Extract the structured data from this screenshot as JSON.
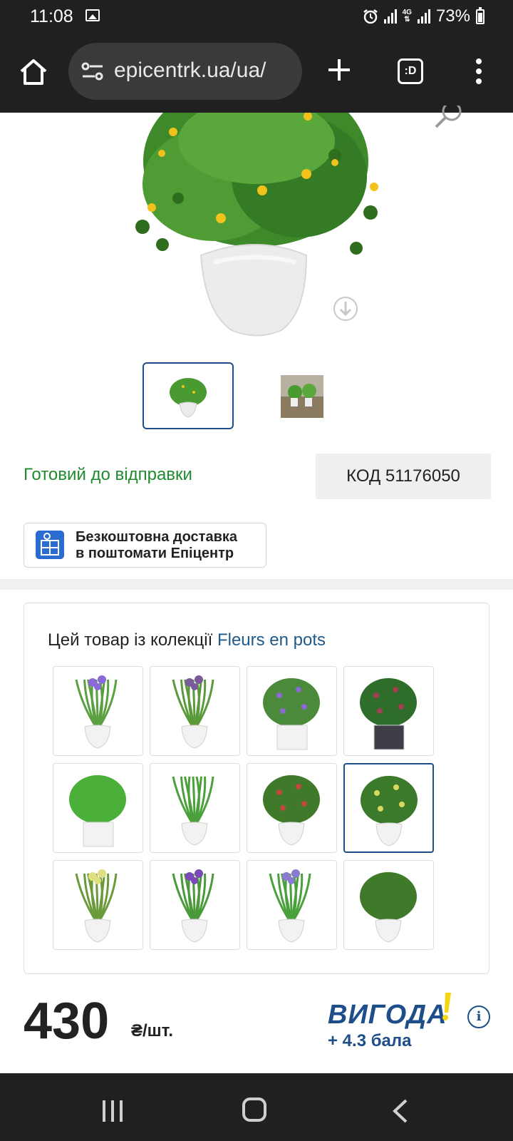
{
  "status_bar": {
    "time": "11:08",
    "network": "4G",
    "battery": "73%"
  },
  "browser": {
    "url": "epicentrk.ua/ua/",
    "tabs_label": ":D"
  },
  "product": {
    "ready_status": "Готовий до відправки",
    "code_label": "КОД 51176050",
    "delivery_line1": "Безкоштовна доставка",
    "delivery_line2": "в поштомати Епіцентр"
  },
  "collection": {
    "title_prefix": "Цей товар із колекції ",
    "title_link": "Fleurs en pots",
    "selected_index": 7
  },
  "price": {
    "amount": "430",
    "unit": "₴/шт.",
    "loyalty_brand": "ВИГОДА",
    "bonus": "+ 4.3 бала"
  },
  "colors": {
    "accent_blue": "#1e4e8a",
    "ready_green": "#1f8a2e",
    "loyalty_yellow": "#f5d60f"
  }
}
